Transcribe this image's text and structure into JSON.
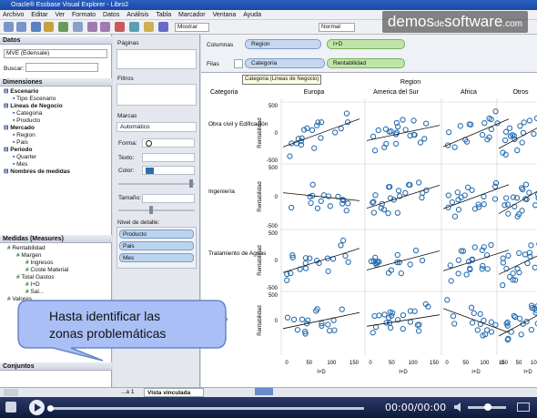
{
  "window": {
    "title": "Oracle® Essbase Visual Explorer - Libro2"
  },
  "menu": [
    "Archivo",
    "Editar",
    "Ver",
    "Formato",
    "Datos",
    "Análisis",
    "Tabla",
    "Marcador",
    "Ventana",
    "Ayuda"
  ],
  "toolbar": {
    "show_label": "Mostrar",
    "size_value": "Normal"
  },
  "logo": {
    "text_a": "demos",
    "text_b": "de",
    "text_c": "software",
    "text_d": ".com"
  },
  "data_section": {
    "title": "Datos",
    "source": "MVE (Edensale)",
    "search_label": "Buscar:"
  },
  "dimensions": {
    "title": "Dimensiones",
    "items": [
      {
        "label": "Escenario",
        "level": 0
      },
      {
        "label": "Tipo Escenario",
        "level": 1
      },
      {
        "label": "Lineas de Negocio",
        "level": 0
      },
      {
        "label": "Categoria",
        "level": 1
      },
      {
        "label": "Producto",
        "level": 1
      },
      {
        "label": "Mercado",
        "level": 0
      },
      {
        "label": "Region",
        "level": 1
      },
      {
        "label": "Pais",
        "level": 1
      },
      {
        "label": "Periodo",
        "level": 0
      },
      {
        "label": "Quarter",
        "level": 1
      },
      {
        "label": "Mes",
        "level": 1
      },
      {
        "label": "Nombres de medidas",
        "level": 0
      }
    ]
  },
  "measures": {
    "title": "Medidas (Measures)",
    "items": [
      {
        "label": "Rentabilidad",
        "level": 0
      },
      {
        "label": "Margen",
        "level": 1
      },
      {
        "label": "Ingresos",
        "level": 2
      },
      {
        "label": "Coste Material",
        "level": 2
      },
      {
        "label": "Total Gastos",
        "level": 1
      },
      {
        "label": "I+D",
        "level": 2
      },
      {
        "label": "Sal...",
        "level": 2
      },
      {
        "label": "Valores...",
        "level": 0
      }
    ]
  },
  "sets": {
    "title": "Conjuntos"
  },
  "mid": {
    "pages": "Páginas",
    "filters": "Filtros",
    "marks": "Marcas",
    "mark_type": "Automático",
    "shape": "Forma:",
    "text": "Texto:",
    "color": "Color:",
    "size": "Tamaño:",
    "detail": "Nivel de detalle:",
    "detail_items": [
      "Producto",
      "Pais",
      "Mes"
    ]
  },
  "shelves": {
    "columns_label": "Columnas",
    "rows_label": "Filas",
    "col_pills": [
      "Region",
      "I+D"
    ],
    "row_pills": [
      "Categoria",
      "Rentabilidad"
    ],
    "tooltip": "Categoria (Lineas de Negocio)"
  },
  "chart_data": {
    "type": "scatter",
    "col_header": "Region",
    "row_header": "Categoria",
    "regions": [
      "Europa",
      "America del Sur",
      "Africa",
      "Otros"
    ],
    "categories": [
      "Obra civil y Edificación",
      "Ingeniería",
      "Tratamiento de Aguas",
      "...uctos"
    ],
    "ylabel": "Rentabilidad",
    "xlabel": "I+D",
    "yticks": [
      "500",
      "0",
      "-500"
    ],
    "xticks": [
      "0",
      "50",
      "100",
      "150"
    ]
  },
  "bubble": {
    "line1": "Hasta identificar las",
    "line2": "zonas problemáticas"
  },
  "tabs": [
    "...a 1",
    "Vista vinculada"
  ],
  "player": {
    "time": "00:00/00:00"
  }
}
